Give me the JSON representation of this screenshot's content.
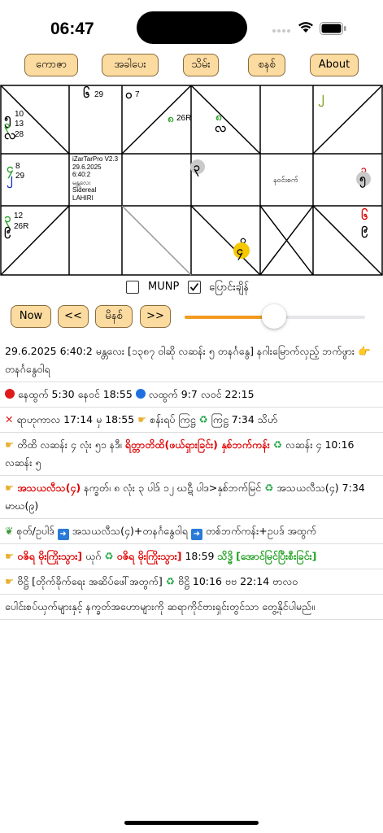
{
  "status": {
    "time": "06:47"
  },
  "top_buttons": [
    "ကောဇာ",
    "အခါပေး",
    "သိမ်း",
    "စနစ်",
    "About"
  ],
  "chart": {
    "cells": {
      "c00": {
        "main": "၅",
        "sub": "၃",
        "lower": "လ",
        "nums": [
          "10",
          "13",
          "28"
        ]
      },
      "c01": {
        "main": "၆",
        "num": "29"
      },
      "c02": {
        "main": "၀",
        "num": "7",
        "mid": "၈",
        "mid_num": "26R"
      },
      "c03": {
        "main": "၈",
        "lower": "လ"
      },
      "c05": {
        "main": "၂"
      },
      "c10": {
        "main1": "၄",
        "main2": "၂",
        "nums": [
          "8",
          "29"
        ]
      },
      "c11": {
        "lines": [
          "iZarTarPro V2.3",
          "29.6.2025",
          "6:40:2",
          "မန္တလေး",
          "Sidereal",
          "LAHIRI"
        ]
      },
      "c13": {
        "main": "၃"
      },
      "c14": {
        "text": "နဝင်းစက်"
      },
      "c15": {
        "main1": "၁",
        "main2": "၅"
      },
      "c20": {
        "main1": "၃",
        "main2": "၉",
        "nums": [
          "12",
          "26R"
        ]
      },
      "c23": {
        "top": "၀",
        "main": "၄"
      },
      "c25": {
        "main1": "၆",
        "main2": "၉"
      }
    }
  },
  "checkboxes": [
    {
      "label": "MUNP",
      "checked": false
    },
    {
      "label": "ပြောင်းချိန်",
      "checked": true
    }
  ],
  "nav": {
    "now": "Now",
    "prev": "<<",
    "date": "မိနစ်",
    "next": ">>"
  },
  "slider": {
    "value": 0.49
  },
  "info": {
    "l1": "29.6.2025 6:40:2 မန္တလေး [၁၃၈၇ ဝါဆို လဆန်း ၅ တနင်္ဂနွေ] နဂါးမြောက်လှည့် ဘက်ဖွား 👉 တနင်္ဂနွေဝါရ",
    "l2a": "နေထွက် 5:30 နေဝင် 18:55",
    "l2b": "လထွက် 9:7 လဝင် 22:15",
    "l3a": "ရာဟုကာလ 17:14 မှ 18:55",
    "l3b": "စန်းရပ် ကြဋ္ဌ",
    "l3c": "ကြဋ္ဌ 7:34 သိဟ်",
    "l4a": "တိထိ လဆန်း ၄ လုံး ၅၁ နဒီ၊ ",
    "l4red": "ရိတ္တာတိထိ(ဖယ်ရှားခြင်း) နှစ်ဘက်ကန်း",
    "l4b": "လဆန်း ၄ 10:16 လဆန်း ၅",
    "l5red": "အသယလီသ(၄)",
    "l5a": "နက္ခတ်၊ ၈ လုံး ၃ ပါဒ် ၁၂ ဃဋီ ပါဒ>နှစ်ဘက်မြင်",
    "l5b": "အသယလီသ(၄) 7:34 မာဃ(၉)",
    "l6a": "စုတ်/ဥပါဒ်",
    "l6b": "အသယလီသ(၄)+တနင်္ဂနွေဝါရ",
    "l6c": "တစ်ဘက်ကန်း+ဥပဒ် အထွက်",
    "l7red1": "ဝဇိရ မိုးကြိုးသွား]",
    "l7a": "ယုဂ်",
    "l7red2": "ဝဇိရ မိုးကြိုးသွား]",
    "l7b": "18:59",
    "l7green1": "သိဒ္ဓိ",
    "l7green2": "[အောင်မြင်ပြီးစီးခြင်း]",
    "l8a": "ဗိဋ္ဌိ [တိုက်ခိုက်ရေး အဆိပ်ဖေါ်အတွက်]",
    "l8b": "ဗိဋ္ဌိ 10:16 ဗဗ 22:14 ဗာလဝ",
    "l9": "ပေါင်းစပ်ယှက်များနှင့် နက္ခတ်အဟောများကို ဆရာကိုင်ဗားရှင်းတွင်သာ တွေ့နိုင်ပါမည်။"
  },
  "colors": {
    "accent": "#f29a1f",
    "button_bg": "#fcdba0",
    "red": "#e00000",
    "green": "#1e9e1e"
  }
}
